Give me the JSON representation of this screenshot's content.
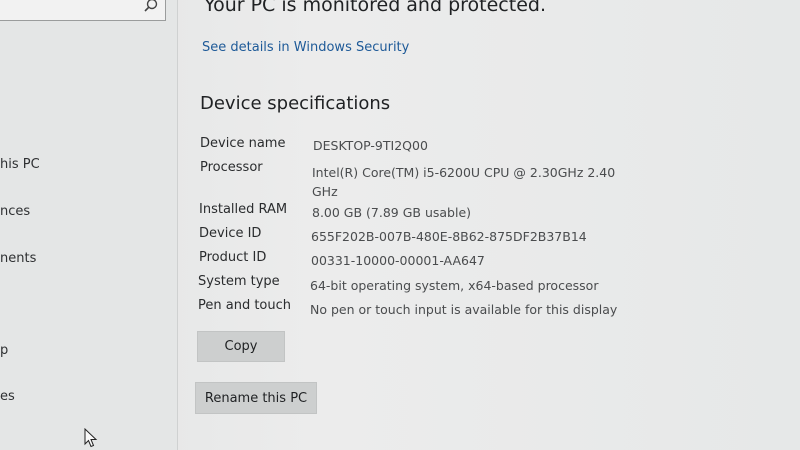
{
  "status": {
    "text": "Your PC is monitored and protected.",
    "link": "See details in Windows Security"
  },
  "sidebar": {
    "items": [
      {
        "label": "his PC"
      },
      {
        "label": "nces"
      },
      {
        "label": "nents"
      },
      {
        "label": "p"
      },
      {
        "label": "es"
      }
    ]
  },
  "device_specs": {
    "title": "Device specifications",
    "rows": [
      {
        "label": "Device name",
        "value": "DESKTOP-9TI2Q00"
      },
      {
        "label": "Processor",
        "value": "Intel(R) Core(TM) i5-6200U CPU @ 2.30GHz   2.40 GHz"
      },
      {
        "label": "Installed RAM",
        "value": "8.00 GB (7.89 GB usable)"
      },
      {
        "label": "Device ID",
        "value": "655F202B-007B-480E-8B62-875DF2B37B14"
      },
      {
        "label": "Product ID",
        "value": "00331-10000-00001-AA647"
      },
      {
        "label": "System type",
        "value": "64-bit operating system, x64-based processor"
      },
      {
        "label": "Pen and touch",
        "value": "No pen or touch input is available for this display"
      }
    ],
    "copy_button": "Copy",
    "rename_button": "Rename this PC"
  },
  "icons": {
    "search": "search-icon",
    "cursor": "mouse-pointer-icon"
  }
}
